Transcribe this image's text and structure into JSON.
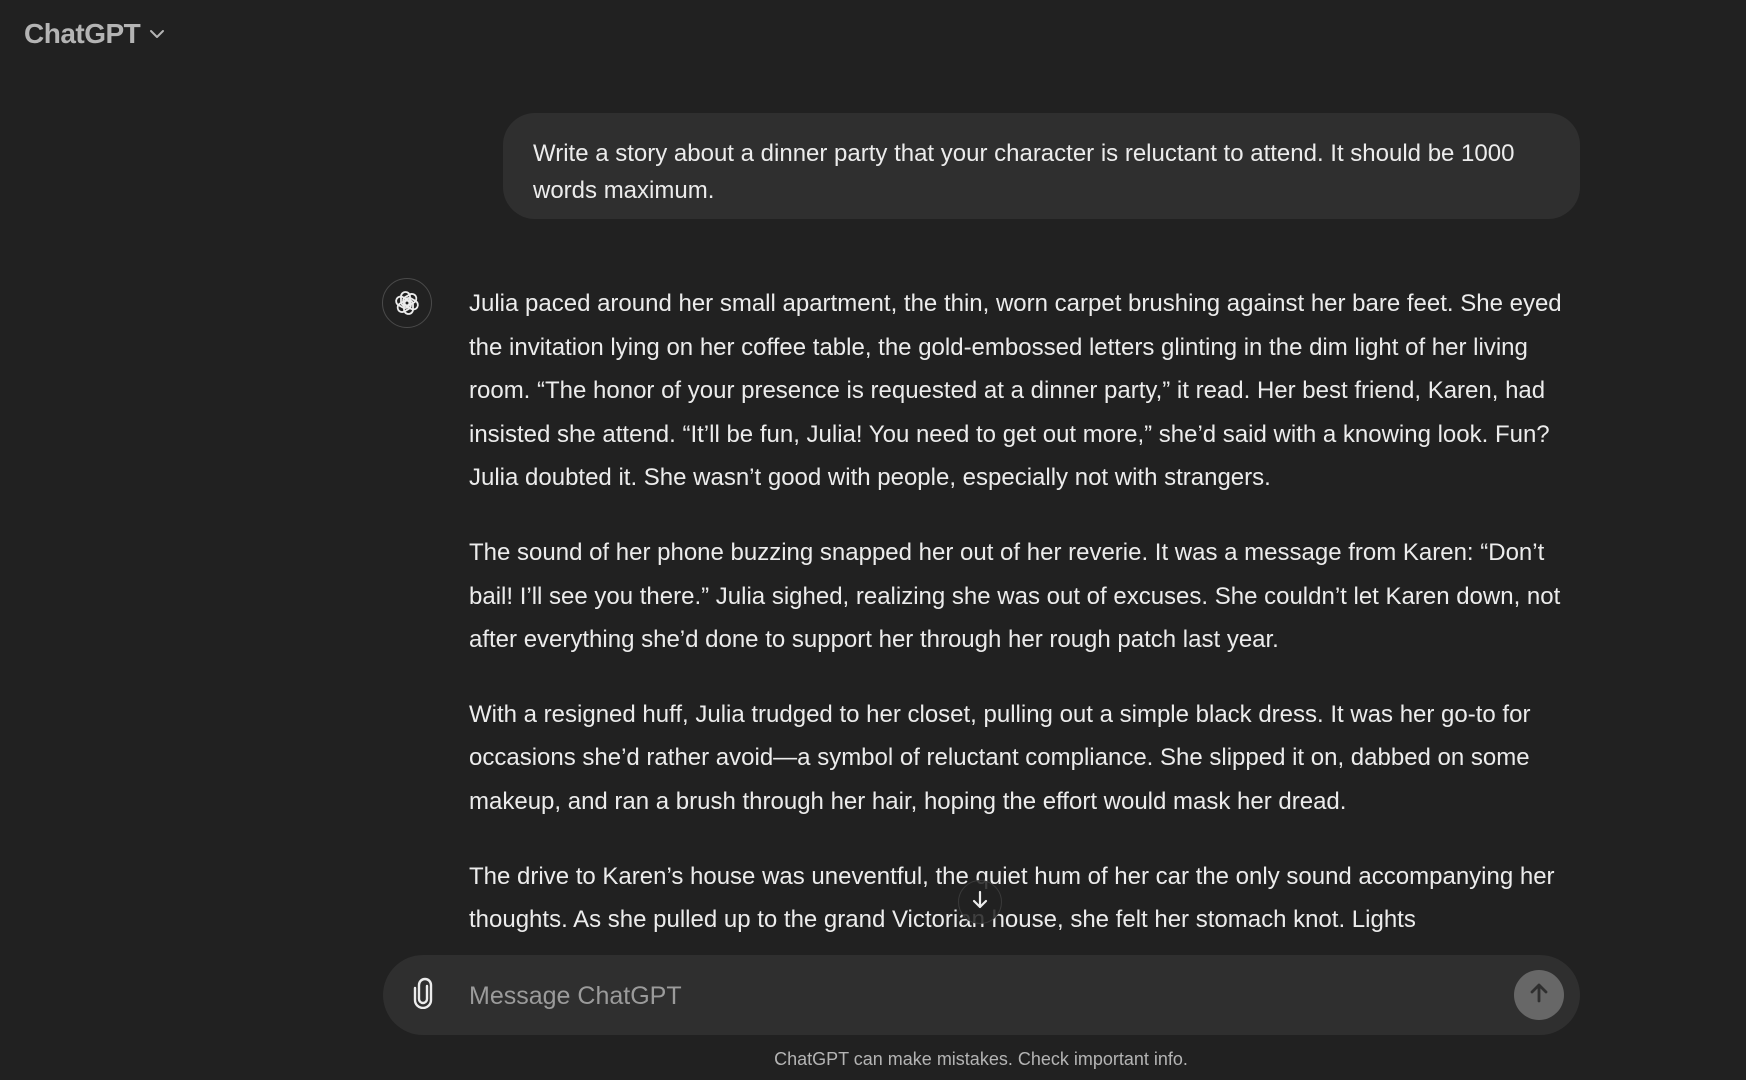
{
  "header": {
    "model_name": "ChatGPT",
    "chevron_icon": "chevron-down-icon"
  },
  "conversation": {
    "user_message": "Write a story about a dinner party that your character is reluctant to attend. It should be 1000 words maximum.",
    "assistant_avatar_icon": "openai-logo-icon",
    "assistant_paragraphs": [
      "Julia paced around her small apartment, the thin, worn carpet brushing against her bare feet. She eyed the invitation lying on her coffee table, the gold-embossed letters glinting in the dim light of her living room. “The honor of your presence is requested at a dinner party,” it read. Her best friend, Karen, had insisted she attend. “It’ll be fun, Julia! You need to get out more,” she’d said with a knowing look. Fun? Julia doubted it. She wasn’t good with people, especially not with strangers.",
      "The sound of her phone buzzing snapped her out of her reverie. It was a message from Karen: “Don’t bail! I’ll see you there.” Julia sighed, realizing she was out of excuses. She couldn’t let Karen down, not after everything she’d done to support her through her rough patch last year.",
      "With a resigned huff, Julia trudged to her closet, pulling out a simple black dress. It was her go-to for occasions she’d rather avoid—a symbol of reluctant compliance. She slipped it on, dabbed on some makeup, and ran a brush through her hair, hoping the effort would mask her dread.",
      "The drive to Karen’s house was uneventful, the quiet hum of her car the only sound accompanying her thoughts. As she pulled up to the grand Victorian house, she felt her stomach knot. Lights"
    ]
  },
  "composer": {
    "placeholder": "Message ChatGPT",
    "value": "",
    "attach_icon": "paperclip-icon",
    "send_icon": "arrow-up-icon"
  },
  "scroll_button_icon": "arrow-down-icon",
  "footer": {
    "disclaimer": "ChatGPT can make mistakes. Check important info."
  },
  "colors": {
    "background": "#212121",
    "bubble": "#2f2f2f",
    "text": "#ececec",
    "muted": "#b4b4b4",
    "send_button": "#676767"
  }
}
